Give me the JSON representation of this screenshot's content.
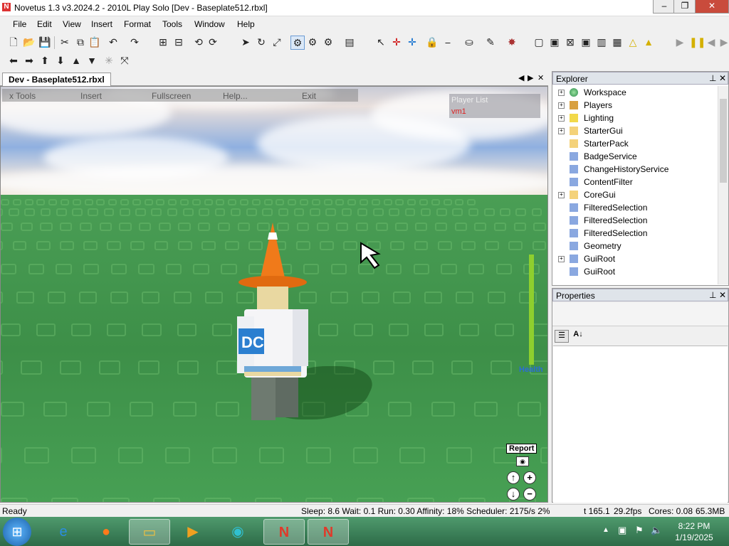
{
  "window": {
    "title": "Novetus 1.3 v3.2024.2 - 2010L Play Solo [Dev - Baseplate512.rbxl]",
    "minimize": "–",
    "maximize": "❐",
    "close": "✕"
  },
  "menubar": [
    "File",
    "Edit",
    "View",
    "Insert",
    "Format",
    "Tools",
    "Window",
    "Help"
  ],
  "document_tab": {
    "label": "Dev - Baseplate512.rbxl",
    "close": "✕"
  },
  "ingame": {
    "menu": [
      "x Tools",
      "Insert",
      "Fullscreen",
      "Help...",
      "Exit"
    ],
    "player_list_title": "Player List",
    "player_name": "vm1",
    "health_label": "Health",
    "report_label": "Report"
  },
  "explorer": {
    "title": "Explorer",
    "items": [
      {
        "label": "Workspace",
        "expandable": true,
        "icon": "globe-icon"
      },
      {
        "label": "Players",
        "expandable": true,
        "icon": "players-icon"
      },
      {
        "label": "Lighting",
        "expandable": true,
        "icon": "lightbulb-icon"
      },
      {
        "label": "StarterGui",
        "expandable": true,
        "icon": "folder-icon"
      },
      {
        "label": "StarterPack",
        "expandable": false,
        "icon": "folder-icon"
      },
      {
        "label": "BadgeService",
        "expandable": false,
        "icon": "service-icon"
      },
      {
        "label": "ChangeHistoryService",
        "expandable": false,
        "icon": "service-icon"
      },
      {
        "label": "ContentFilter",
        "expandable": false,
        "icon": "service-icon"
      },
      {
        "label": "CoreGui",
        "expandable": true,
        "icon": "folder-icon"
      },
      {
        "label": "FilteredSelection",
        "expandable": false,
        "icon": "service-icon"
      },
      {
        "label": "FilteredSelection",
        "expandable": false,
        "icon": "service-icon"
      },
      {
        "label": "FilteredSelection",
        "expandable": false,
        "icon": "service-icon"
      },
      {
        "label": "Geometry",
        "expandable": false,
        "icon": "service-icon"
      },
      {
        "label": "GuiRoot",
        "expandable": true,
        "icon": "service-icon"
      },
      {
        "label": "GuiRoot",
        "expandable": false,
        "icon": "service-icon"
      }
    ]
  },
  "properties": {
    "title": "Properties"
  },
  "statusbar": {
    "left": "Ready",
    "perf": "Sleep: 8.6 Wait: 0.1 Run: 0.30 Affinity: 18% Scheduler: 2175/s 2%",
    "time": "t 165.1",
    "fps": "29.2fps",
    "cores": "Cores: 0.08",
    "memory": "65.3MB"
  },
  "taskbar": {
    "time": "8:22 PM",
    "date": "1/19/2025"
  },
  "colors": {
    "sky": "#8fb0e0",
    "ground": "#3d8f48",
    "health": "#8ecf2e",
    "taskbar": "#2d6b48",
    "close_button": "#c94b3c"
  }
}
